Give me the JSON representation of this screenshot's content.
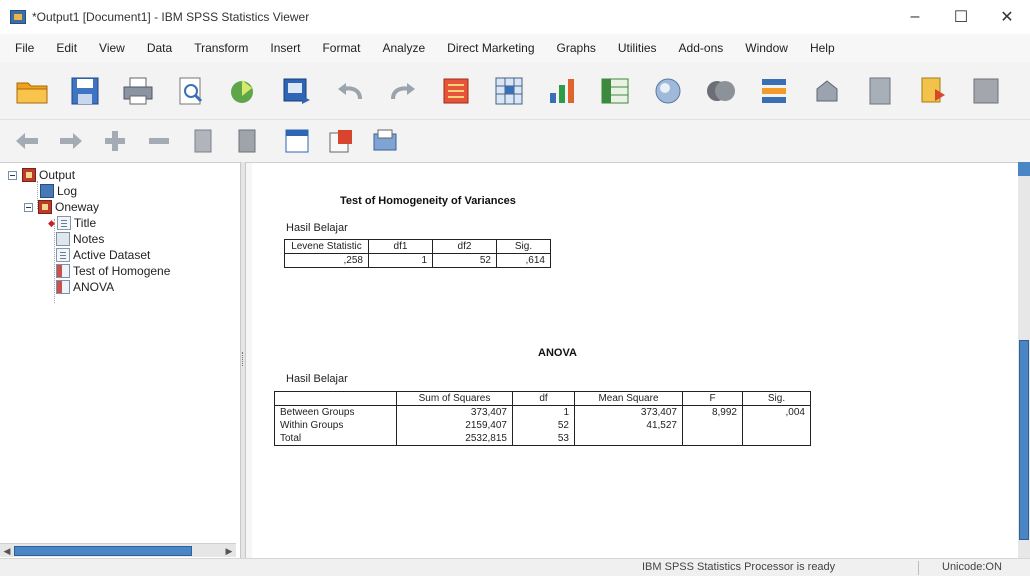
{
  "window": {
    "title": "*Output1 [Document1] - IBM SPSS Statistics Viewer",
    "minimize": "–",
    "maximize": "☐",
    "close": "✕"
  },
  "menu": [
    "File",
    "Edit",
    "View",
    "Data",
    "Transform",
    "Insert",
    "Format",
    "Analyze",
    "Direct Marketing",
    "Graphs",
    "Utilities",
    "Add-ons",
    "Window",
    "Help"
  ],
  "toolbar": {
    "main_icons": [
      "open-folder-icon",
      "save-icon",
      "print-icon",
      "print-preview-icon",
      "export-icon",
      "recall-dialog-icon",
      "undo-icon",
      "redo-icon",
      "goto-data-icon",
      "goto-case-icon",
      "goto-variable-icon",
      "variables-icon",
      "run-descriptive-icon",
      "use-variable-sets-icon",
      "show-all-variables-icon",
      "split-file-icon",
      "designate-window-icon",
      "script-icon",
      "create-edit-autoscript-icon"
    ],
    "nav_icons": [
      "promote-icon",
      "demote-icon",
      "expand-icon",
      "collapse-icon",
      "show-icon",
      "hide-icon",
      "insert-heading-icon",
      "insert-title-icon",
      "insert-text-icon"
    ]
  },
  "tree": {
    "root": "Output",
    "log": "Log",
    "oneway": "Oneway",
    "title": "Title",
    "notes": "Notes",
    "active_dataset": "Active Dataset",
    "test_homogeneity": "Test of Homogene",
    "anova": "ANOVA"
  },
  "homogeneity": {
    "title": "Test of Homogeneity of Variances",
    "variable": "Hasil Belajar",
    "headers": [
      "Levene Statistic",
      "df1",
      "df2",
      "Sig."
    ],
    "row": [
      ",258",
      "1",
      "52",
      ",614"
    ]
  },
  "anova": {
    "title": "ANOVA",
    "variable": "Hasil Belajar",
    "headers": [
      "",
      "Sum of Squares",
      "df",
      "Mean Square",
      "F",
      "Sig."
    ],
    "rows": [
      {
        "label": "Between Groups",
        "ss": "373,407",
        "df": "1",
        "ms": "373,407",
        "f": "8,992",
        "sig": ",004"
      },
      {
        "label": "Within Groups",
        "ss": "2159,407",
        "df": "52",
        "ms": "41,527",
        "f": "",
        "sig": ""
      },
      {
        "label": "Total",
        "ss": "2532,815",
        "df": "53",
        "ms": "",
        "f": "",
        "sig": ""
      }
    ]
  },
  "status": {
    "processor": "IBM SPSS Statistics Processor is ready",
    "unicode": "Unicode:ON"
  }
}
